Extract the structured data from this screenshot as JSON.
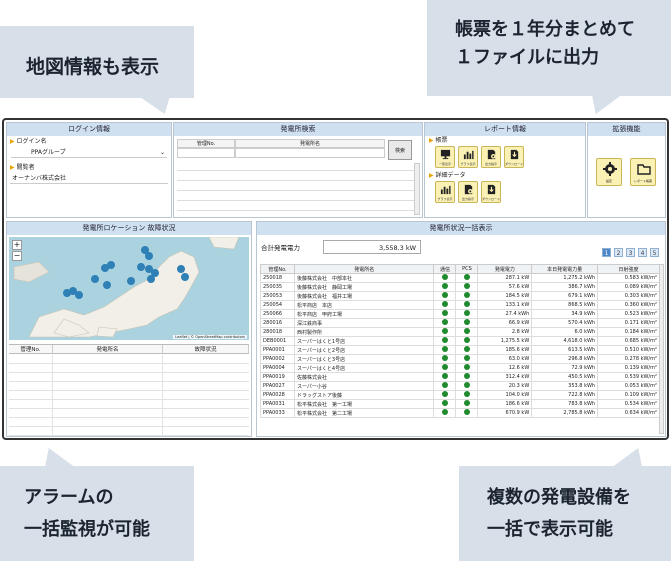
{
  "callouts": {
    "map_info": "地図情報も表示",
    "report_line1": "帳票を１年分まとめて",
    "report_line2": "１ファイルに出力",
    "alarm_line1": "アラームの",
    "alarm_line2": "一括監視が可能",
    "multi_line1": "複数の発電設備を",
    "multi_line2": "一括で表示可能"
  },
  "login_panel": {
    "title": "ログイン情報",
    "login_label": "ログイン名",
    "login_value": "PPAグループ",
    "viewer_label": "閲覧者",
    "viewer_value": "オーナンバ株式会社"
  },
  "search_panel": {
    "title": "発電所検索",
    "col_id": "管理No.",
    "col_name": "発電所名",
    "button": "検索"
  },
  "report_panel": {
    "title": "レポート情報",
    "section_report": "帳票",
    "section_detail": "詳細データ",
    "report_icons": [
      "一覧表示",
      "グラフ表示",
      "出力指示",
      "ダウンロード"
    ],
    "detail_icons": [
      "グラフ表示",
      "出力指示",
      "ダウンロード"
    ]
  },
  "expand_panel": {
    "title": "拡張機能",
    "icons": [
      "設定",
      "レポート帳票"
    ]
  },
  "map_panel": {
    "title": "発電所ロケーション 故障状況",
    "zoom_in": "+",
    "zoom_out": "−",
    "attribution": "Leaflet | © OpenStreetMap contributors",
    "alarm_cols": [
      "管理No.",
      "発電所名",
      "故障状況"
    ]
  },
  "status_panel": {
    "title": "発電所状況一括表示",
    "total_label": "合計発電電力",
    "total_value": "3,558.3 kW",
    "pages": [
      "1",
      "2",
      "3",
      "4",
      "5"
    ],
    "columns": [
      "管理No.",
      "発電所名",
      "通信",
      "PCS",
      "発電電力",
      "本日発電電力量",
      "日射強度"
    ],
    "rows": [
      {
        "id": "250018",
        "name": "後藤株式会社　中部本社",
        "power": "287.1 kW",
        "energy": "1,275.2 kWh",
        "irr": "0.583 kW/m²"
      },
      {
        "id": "250035",
        "name": "後藤株式会社　静岡工場",
        "power": "57.6 kW",
        "energy": "386.7 kWh",
        "irr": "0.089 kW/m²"
      },
      {
        "id": "250053",
        "name": "後藤株式会社　福井工場",
        "power": "184.5 kW",
        "energy": "679.1 kWh",
        "irr": "0.303 kW/m²"
      },
      {
        "id": "250054",
        "name": "松平商店　本店",
        "power": "133.1 kW",
        "energy": "868.5 kWh",
        "irr": "0.360 kW/m²"
      },
      {
        "id": "250066",
        "name": "松平商店　甲府工場",
        "power": "27.4 kWh",
        "energy": "34.9 kWh",
        "irr": "0.523 kW/m²"
      },
      {
        "id": "280016",
        "name": "深江鉄商事",
        "power": "66.9 kW",
        "energy": "570.4 kWh",
        "irr": "0.171 kW/m²"
      },
      {
        "id": "280018",
        "name": "西村製作所",
        "power": "2.8 kW",
        "energy": "6.0 kWh",
        "irr": "0.184 kW/m²"
      },
      {
        "id": "DEB0001",
        "name": "スーパーはくと1号店",
        "power": "1,275.5 kW",
        "energy": "4,618.0 kWh",
        "irr": "0.685 kW/m²"
      },
      {
        "id": "PPA0001",
        "name": "スーパーはくと2号店",
        "power": "185.6 kW",
        "energy": "613.5 kWh",
        "irr": "0.510 kW/m²"
      },
      {
        "id": "PPA0002",
        "name": "スーパーはくと3号店",
        "power": "63.0 kW",
        "energy": "296.8 kWh",
        "irr": "0.278 kW/m²"
      },
      {
        "id": "PPA0004",
        "name": "スーパーはくと4号店",
        "power": "12.6 kW",
        "energy": "72.9 kWh",
        "irr": "0.139 kW/m²"
      },
      {
        "id": "PPA0019",
        "name": "佐藤株式会社",
        "power": "312.4 kW",
        "energy": "450.5 kWh",
        "irr": "0.539 kW/m²"
      },
      {
        "id": "PPA0027",
        "name": "スーパー小谷",
        "power": "20.3 kW",
        "energy": "353.8 kWh",
        "irr": "0.053 kW/m²"
      },
      {
        "id": "PPA0028",
        "name": "ドラッグストア後藤",
        "power": "104.0 kW",
        "energy": "722.8 kWh",
        "irr": "0.109 kW/m²"
      },
      {
        "id": "PPA0031",
        "name": "松平株式会社　第一工場",
        "power": "186.6 kW",
        "energy": "783.8 kWh",
        "irr": "0.534 kW/m²"
      },
      {
        "id": "PPA0033",
        "name": "松平株式会社　第二工場",
        "power": "670.9 kW",
        "energy": "2,785.8 kWh",
        "irr": "0.634 kW/m²"
      }
    ]
  },
  "colors": {
    "header_bg": "#cfe0f1",
    "ok_dot": "#1f8a2e",
    "icon_bg": "#fbf1b4",
    "callout_bg": "#d7dfe8",
    "pin": "#2f80b6"
  }
}
